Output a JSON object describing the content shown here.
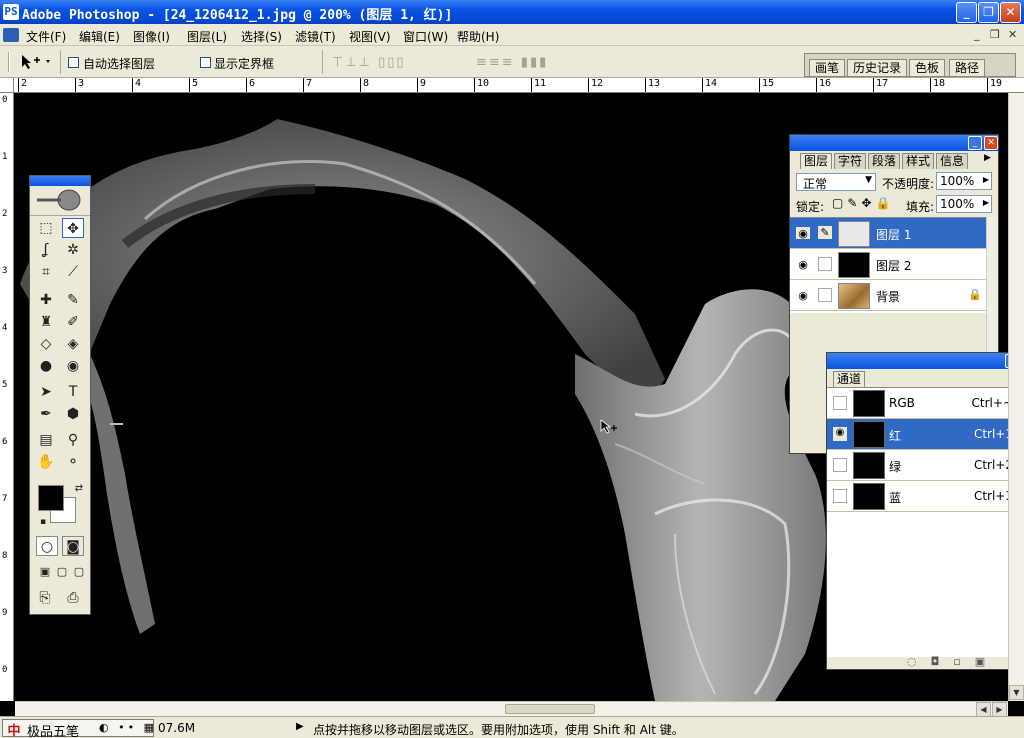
{
  "window": {
    "app_icon": "PS",
    "title": "Adobe Photoshop - [24_1206412_1.jpg @ 200% (图层 1, 红)]",
    "minimize": "_",
    "restore": "❐",
    "close": "✕"
  },
  "menu": {
    "items": [
      "文件(F)",
      "编辑(E)",
      "图像(I)",
      "图层(L)",
      "选择(S)",
      "滤镜(T)",
      "视图(V)",
      "窗口(W)",
      "帮助(H)"
    ],
    "doc_controls": [
      "_",
      "❐",
      "✕"
    ]
  },
  "options_bar": {
    "auto_select_label": "自动选择图层",
    "show_bounds_label": "显示定界框",
    "align_icons_1": "⊤⊥⊥ ▯▯▯",
    "align_icons_2": "≡≡≡ ▮▮▮"
  },
  "palette_well": {
    "tabs": [
      "画笔",
      "历史记录",
      "色板",
      "路径"
    ]
  },
  "rulers": {
    "h_labels": [
      "2",
      "3",
      "4",
      "5",
      "6",
      "7",
      "8",
      "9",
      "10",
      "11",
      "12",
      "13",
      "14",
      "15",
      "16",
      "17",
      "18",
      "19"
    ],
    "v_labels": [
      "0",
      "1",
      "2",
      "3",
      "4",
      "5",
      "6",
      "7",
      "8",
      "9",
      "0"
    ]
  },
  "layers_panel": {
    "tabs": [
      "图层",
      "字符",
      "段落",
      "样式",
      "信息"
    ],
    "blend_mode": "正常",
    "opacity_label": "不透明度:",
    "opacity_value": "100%",
    "lock_label": "锁定:",
    "fill_label": "填充:",
    "fill_value": "100%",
    "layers": [
      {
        "name": "图层 1"
      },
      {
        "name": "图层 2"
      },
      {
        "name": "背景"
      }
    ]
  },
  "channels_panel": {
    "tab": "通道",
    "channels": [
      {
        "name": "RGB",
        "shortcut": "Ctrl+~"
      },
      {
        "name": "红",
        "shortcut": "Ctrl+1"
      },
      {
        "name": "绿",
        "shortcut": "Ctrl+2"
      },
      {
        "name": "蓝",
        "shortcut": "Ctrl+3"
      }
    ]
  },
  "status": {
    "ime_name": "极品五笔",
    "ime_icons": "◐ •• ▦",
    "doc_size": "07.6M",
    "hint": "点按并拖移以移动图层或选区。要用附加选项，使用 Shift 和 Alt 键。"
  },
  "colors": {
    "title_blue": "#0a53e3",
    "selection_blue": "#316ac5",
    "chrome": "#ece9d8"
  }
}
